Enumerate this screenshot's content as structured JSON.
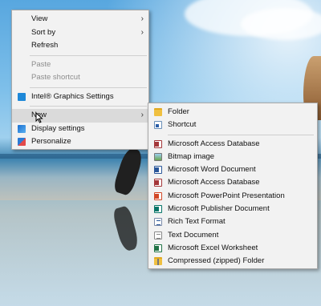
{
  "context_menu": {
    "items": [
      {
        "label": "View",
        "has_submenu": true
      },
      {
        "label": "Sort by",
        "has_submenu": true
      },
      {
        "label": "Refresh"
      },
      {
        "label": "Paste",
        "disabled": true
      },
      {
        "label": "Paste shortcut",
        "disabled": true
      },
      {
        "label": "Intel® Graphics Settings",
        "icon": "intel-graphics-icon"
      },
      {
        "label": "New",
        "has_submenu": true,
        "active": true
      },
      {
        "label": "Display settings",
        "icon": "display-icon"
      },
      {
        "label": "Personalize",
        "icon": "personalize-icon"
      }
    ]
  },
  "new_submenu": {
    "items": [
      {
        "label": "Folder",
        "icon": "folder-icon"
      },
      {
        "label": "Shortcut",
        "icon": "shortcut-icon"
      },
      {
        "label": "Microsoft Access Database",
        "icon": "access-icon"
      },
      {
        "label": "Bitmap image",
        "icon": "bitmap-icon"
      },
      {
        "label": "Microsoft Word Document",
        "icon": "word-icon"
      },
      {
        "label": "Microsoft Access Database",
        "icon": "access-icon"
      },
      {
        "label": "Microsoft PowerPoint Presentation",
        "icon": "powerpoint-icon"
      },
      {
        "label": "Microsoft Publisher Document",
        "icon": "publisher-icon"
      },
      {
        "label": "Rich Text Format",
        "icon": "rtf-icon"
      },
      {
        "label": "Text Document",
        "icon": "text-document-icon"
      },
      {
        "label": "Microsoft Excel Worksheet",
        "icon": "excel-icon"
      },
      {
        "label": "Compressed (zipped) Folder",
        "icon": "zip-folder-icon"
      }
    ]
  },
  "icons": {
    "submenu_arrow": "›"
  }
}
